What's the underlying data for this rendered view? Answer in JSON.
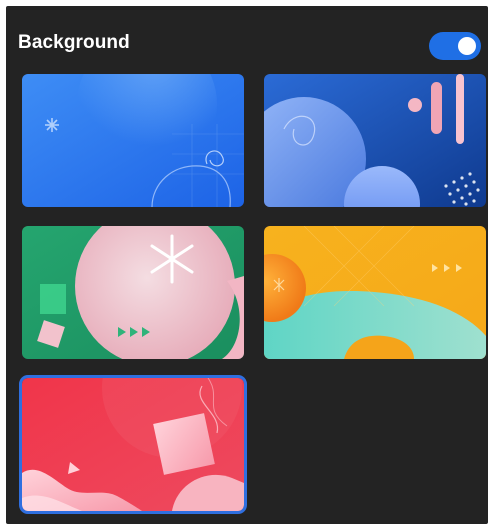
{
  "header": {
    "title": "Background",
    "toggle_on": true
  },
  "colors": {
    "panel": "#232323",
    "accent": "#1f6fe5",
    "selection": "#2f6fe0"
  },
  "backgrounds": [
    {
      "name": "blue-gradient",
      "selected": false
    },
    {
      "name": "navy-shapes",
      "selected": false
    },
    {
      "name": "green-shapes",
      "selected": false
    },
    {
      "name": "orange-waves",
      "selected": false
    },
    {
      "name": "red-waves",
      "selected": true
    }
  ]
}
